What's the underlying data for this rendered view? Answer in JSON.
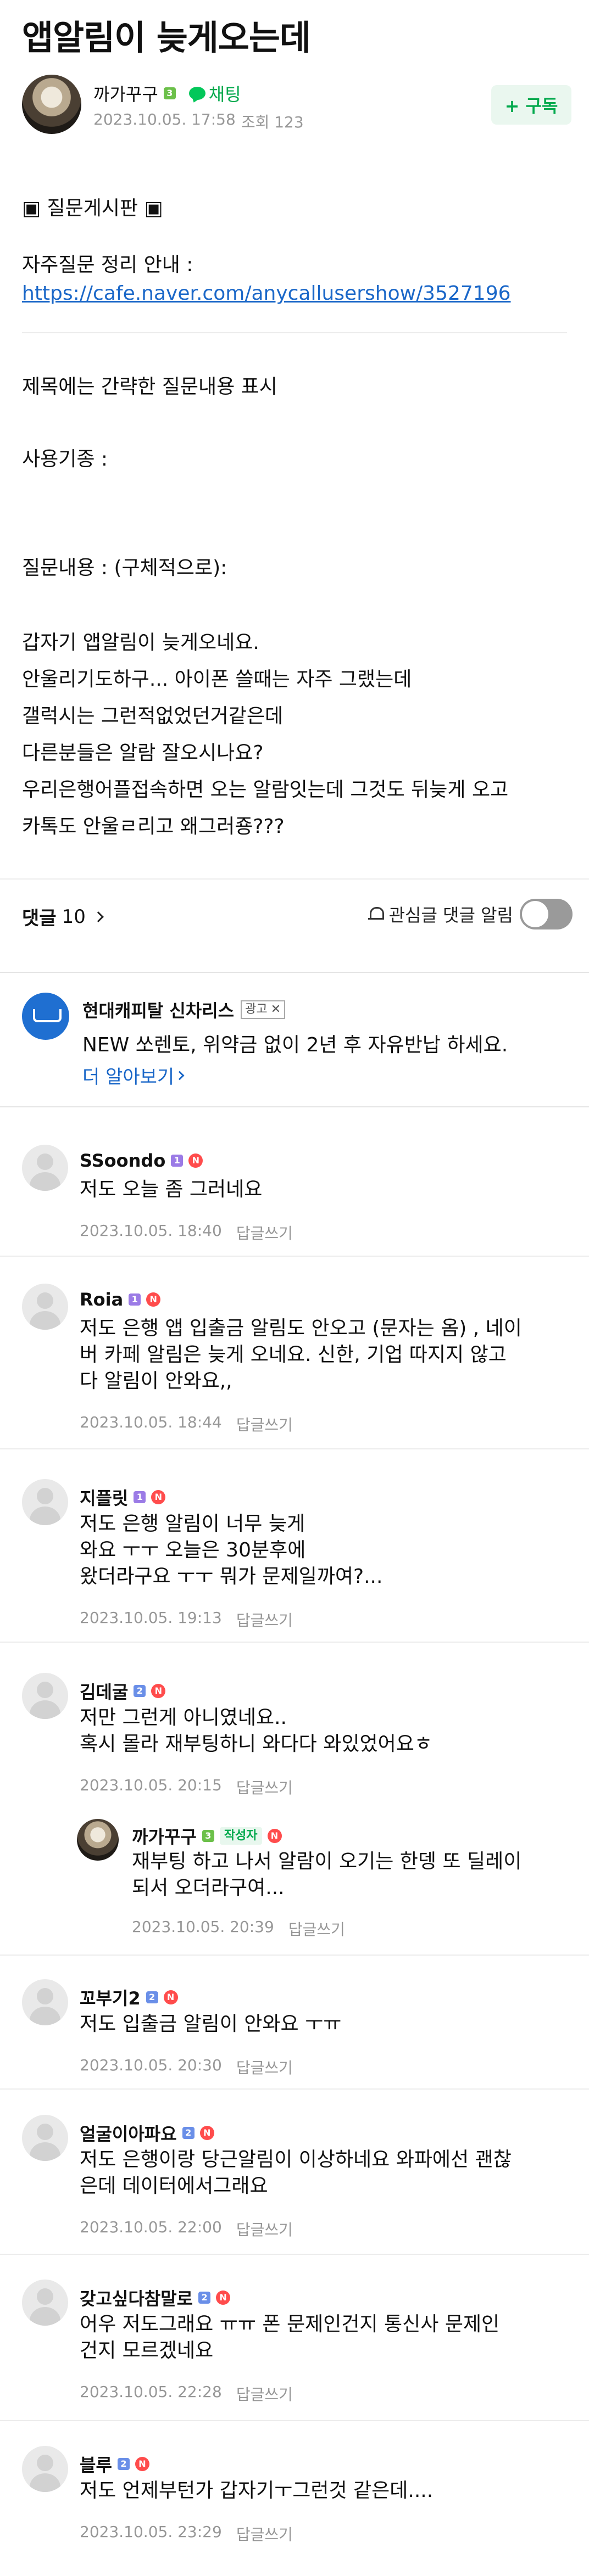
{
  "post": {
    "title": "앱알림이 늦게오는데",
    "author": "까가꾸구",
    "author_level": "3",
    "chat_label": "채팅",
    "date": "2023.10.05. 17:58",
    "views_label": "조회 123",
    "subscribe_label": "+ 구독",
    "board_label": "▣ 질문게시판 ▣",
    "faq_label": "자주질문 정리 안내 :",
    "faq_link": "https://cafe.naver.com/anycallusershow/3527196",
    "template_title": "제목에는 간략한 질문내용 표시",
    "device_label": "사용기종 :",
    "question_label": "질문내용 : (구체적으로):",
    "body_lines": [
      "갑자기 앱알림이 늦게오네요.",
      "안울리기도하구... 아이폰 쓸때는 자주 그랬는데",
      "갤럭시는 그런적없었던거같은데",
      "다른분들은 알람 잘오시나요?",
      "우리은행어플접속하면 오는 알람잇는데 그것도 뒤늦게 오고",
      "카톡도 안울ㄹ리고 왜그러죵???"
    ]
  },
  "comments_bar": {
    "label": "댓글",
    "count": "10",
    "watch_label": "관심글 댓글 알림",
    "watch_on": false
  },
  "ad": {
    "brand": "현대캐피탈 신차리스",
    "tag": "광고",
    "close": "✕",
    "text": "NEW 쏘렌토, 위약금 없이 2년 후 자유반납 하세요.",
    "more": "더 알아보기"
  },
  "reply_label": "답글쓰기",
  "comments": [
    {
      "name": "SSoondo",
      "level": "1",
      "lines": [
        "저도 오늘 좀 그러네요"
      ],
      "date": "2023.10.05. 18:40"
    },
    {
      "name": "Roia",
      "level": "1",
      "lines": [
        "저도 은행 앱 입출금 알림도 안오고 (문자는 옴) , 네이",
        "버 카페 알림은 늦게 오네요. 신한, 기업 따지지 않고",
        "다 알림이 안와요,,"
      ],
      "date": "2023.10.05. 18:44"
    },
    {
      "name": "지플릿",
      "level": "1",
      "lines": [
        "저도 은행 알림이 너무 늦게",
        "와요 ㅜㅜ 오늘은 30분후에",
        "왔더라구요 ㅜㅜ 뭐가 문제일까여?..."
      ],
      "date": "2023.10.05. 19:13"
    },
    {
      "name": "김데굴",
      "level": "2",
      "lines": [
        "저만 그런게 아니였네요..",
        "혹시 몰라 재부팅하니 와다다 와있었어요ㅎ"
      ],
      "date": "2023.10.05. 20:15"
    },
    {
      "name": "까가꾸구",
      "level": "3",
      "writer": "작성자",
      "lines": [
        "재부팅 하고 나서 알람이 오기는 한뎅 또 딜레이",
        "되서 오더라구여..."
      ],
      "date": "2023.10.05. 20:39"
    },
    {
      "name": "꼬부기2",
      "level": "2",
      "lines": [
        "저도 입출금 알림이 안와요 ㅜㅠ"
      ],
      "date": "2023.10.05. 20:30"
    },
    {
      "name": "얼굴이아파요",
      "level": "2",
      "lines": [
        "저도 은행이랑 당근알림이 이상하네요 와파에선 괜찮",
        "은데 데이터에서그래요"
      ],
      "date": "2023.10.05. 22:00"
    },
    {
      "name": "갖고싶다참말로",
      "level": "2",
      "lines": [
        "어우 저도그래요 ㅠㅠ 폰 문제인건지 통신사 문제인",
        "건지 모르겠네요"
      ],
      "date": "2023.10.05. 22:28"
    },
    {
      "name": "블루",
      "level": "2",
      "lines": [
        "저도 언제부턴가 갑자기ㅜ그런것 같은데...."
      ],
      "date": "2023.10.05. 23:29"
    }
  ]
}
